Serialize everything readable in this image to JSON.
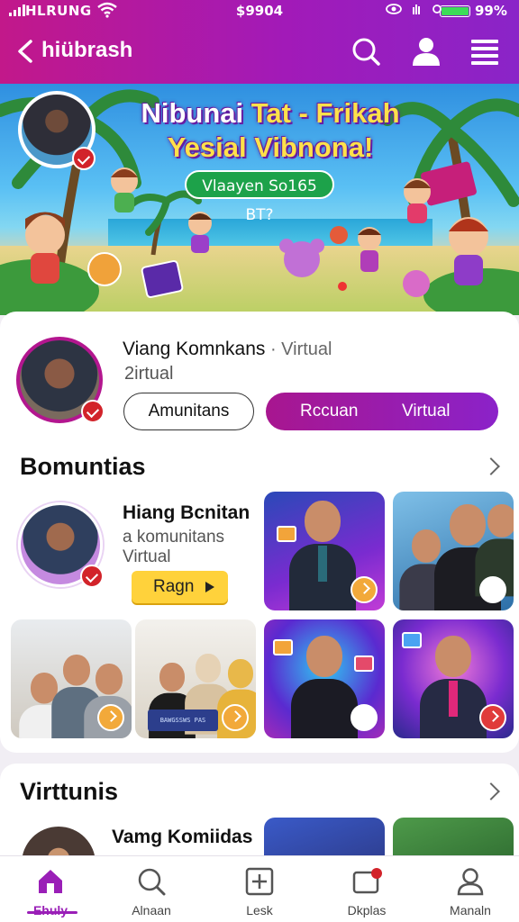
{
  "status_bar": {
    "carrier": "HLRUNG",
    "time": "$9904",
    "battery": "99%",
    "battery_level": 0.99
  },
  "header": {
    "title": "hiübrash"
  },
  "banner": {
    "title_white": "Nibunai ",
    "title_yellow": "Tat - Frikah",
    "title_line2": "Yesial Vibnona!",
    "cta": "Vlaayen So165 BT?"
  },
  "profile": {
    "name": "Viang Komnkans",
    "name_suffix": "Virtual",
    "subtitle": "2irtual",
    "btn_secondary": "Amunitans",
    "btn_primary_left": "Rccuan",
    "btn_primary_right": "Virtual"
  },
  "section1": {
    "title": "Bomuntias",
    "featured": {
      "name": "Hiang Bcnitan",
      "line1": "a komunitans",
      "line2": "Virtual",
      "button": "Ragn"
    }
  },
  "section2": {
    "title": "Virttunis",
    "featured": {
      "name": "Vamg Komiidas",
      "line1": ""
    }
  },
  "tiles_tv_text": "BAWGSSWS PAS",
  "bottom_nav": [
    {
      "label": "Ehuly",
      "icon": "home-icon"
    },
    {
      "label": "Alnaan",
      "icon": "search-icon"
    },
    {
      "label": "Lesk",
      "icon": "plus-square-icon"
    },
    {
      "label": "Dkplas",
      "icon": "notification-icon"
    },
    {
      "label": "Manaln",
      "icon": "profile-icon"
    }
  ],
  "colors": {
    "brand": "#9a1fb7",
    "accent_pink": "#c2188a",
    "cta_yellow": "#ffd23b",
    "badge_red": "#d2232a"
  }
}
